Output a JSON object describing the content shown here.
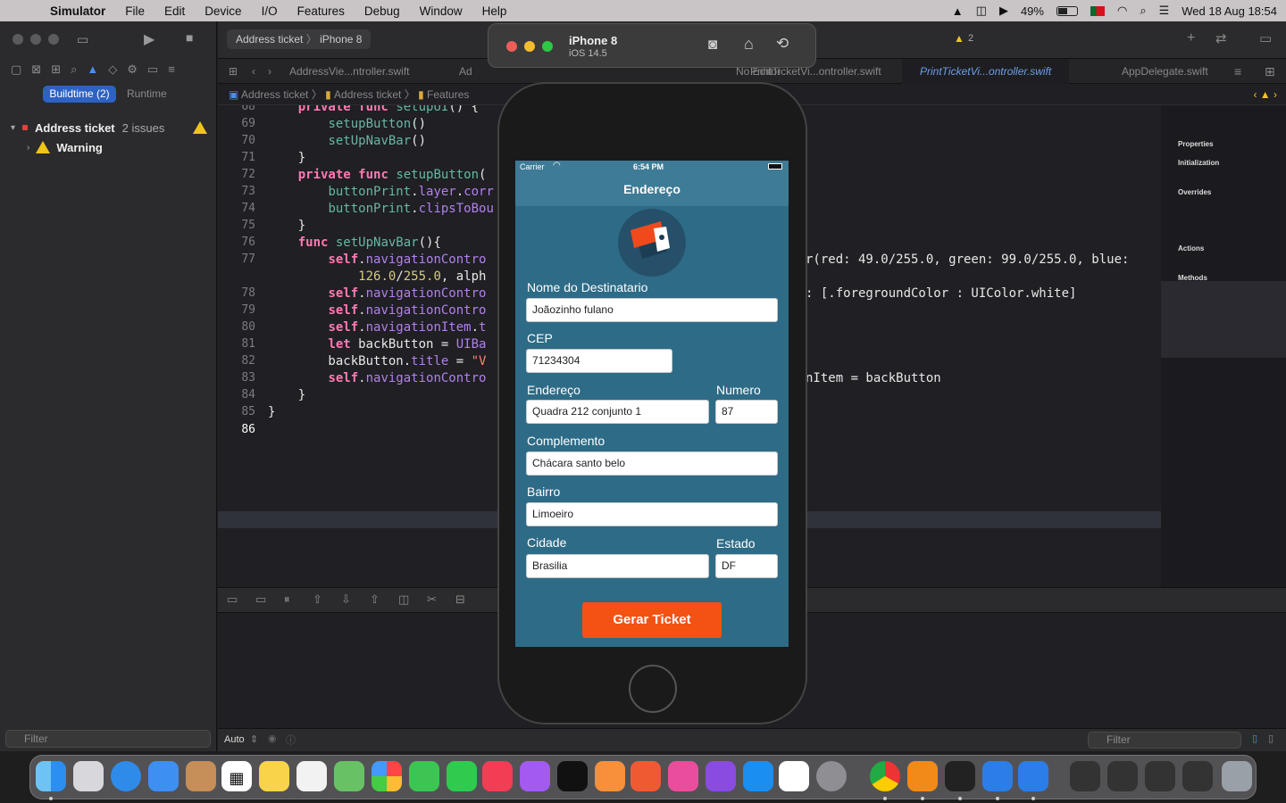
{
  "menubar": {
    "app": "Simulator",
    "items": [
      "File",
      "Edit",
      "Device",
      "I/O",
      "Features",
      "Debug",
      "Window",
      "Help"
    ],
    "battery": "49%",
    "clock": "Wed 18 Aug  18:54"
  },
  "sidebar": {
    "seg_active": "Buildtime (2)",
    "seg_inactive": "Runtime",
    "project_name": "Address ticket",
    "issues": "2 issues",
    "child": "Warning",
    "filter_placeholder": "Filter"
  },
  "toolbar": {
    "scheme": "Address ticket",
    "device": "iPhone 8",
    "warning_count": "2"
  },
  "tabs": {
    "t1": "AddressVie...ntroller.swift",
    "t2": "Ad",
    "t3": "No Editor",
    "t4": "PrintTicketVi...ontroller.swift",
    "t5": "PrintTicketVi...ontroller.swift",
    "t6": "AppDelegate.swift"
  },
  "crumbs": [
    "Address ticket",
    "Address ticket",
    "Features"
  ],
  "code": {
    "numbers": [
      "68",
      "69",
      "70",
      "71",
      "72",
      "73",
      "74",
      "75",
      "76",
      "77",
      "",
      "78",
      "79",
      "80",
      "81",
      "82",
      "83",
      "84",
      "85",
      "86"
    ],
    "right_77": "r(red: 49.0/255.0, green: 99.0/255.0, blue:",
    "right_78": ": [.foregroundColor : UIColor.white]",
    "right_83": "nItem = backButton"
  },
  "minimap": {
    "labels": [
      "Properties",
      "Initialization",
      "Overrides",
      "Actions",
      "Methods"
    ]
  },
  "bottom": {
    "auto": "Auto",
    "filter_placeholder": "Filter"
  },
  "simulator": {
    "device": "iPhone 8",
    "os": "iOS 14.5"
  },
  "phone": {
    "carrier": "Carrier",
    "time": "6:54 PM",
    "nav_title": "Endereço",
    "labels": {
      "nome": "Nome do Destinatario",
      "cep": "CEP",
      "endereco": "Endereço",
      "numero": "Numero",
      "complemento": "Complemento",
      "bairro": "Bairro",
      "cidade": "Cidade",
      "estado": "Estado"
    },
    "values": {
      "nome": "Joãozinho fulano",
      "cep": "71234304",
      "endereco": "Quadra 212 conjunto 1",
      "numero": "87",
      "complemento": "Chácara santo belo",
      "bairro": "Limoeiro",
      "cidade": "Brasilia",
      "estado": "DF"
    },
    "button": "Gerar Ticket"
  },
  "colors": {
    "accent": "#2d62c4",
    "phone_bg": "#2e6b86",
    "button": "#f35212"
  }
}
